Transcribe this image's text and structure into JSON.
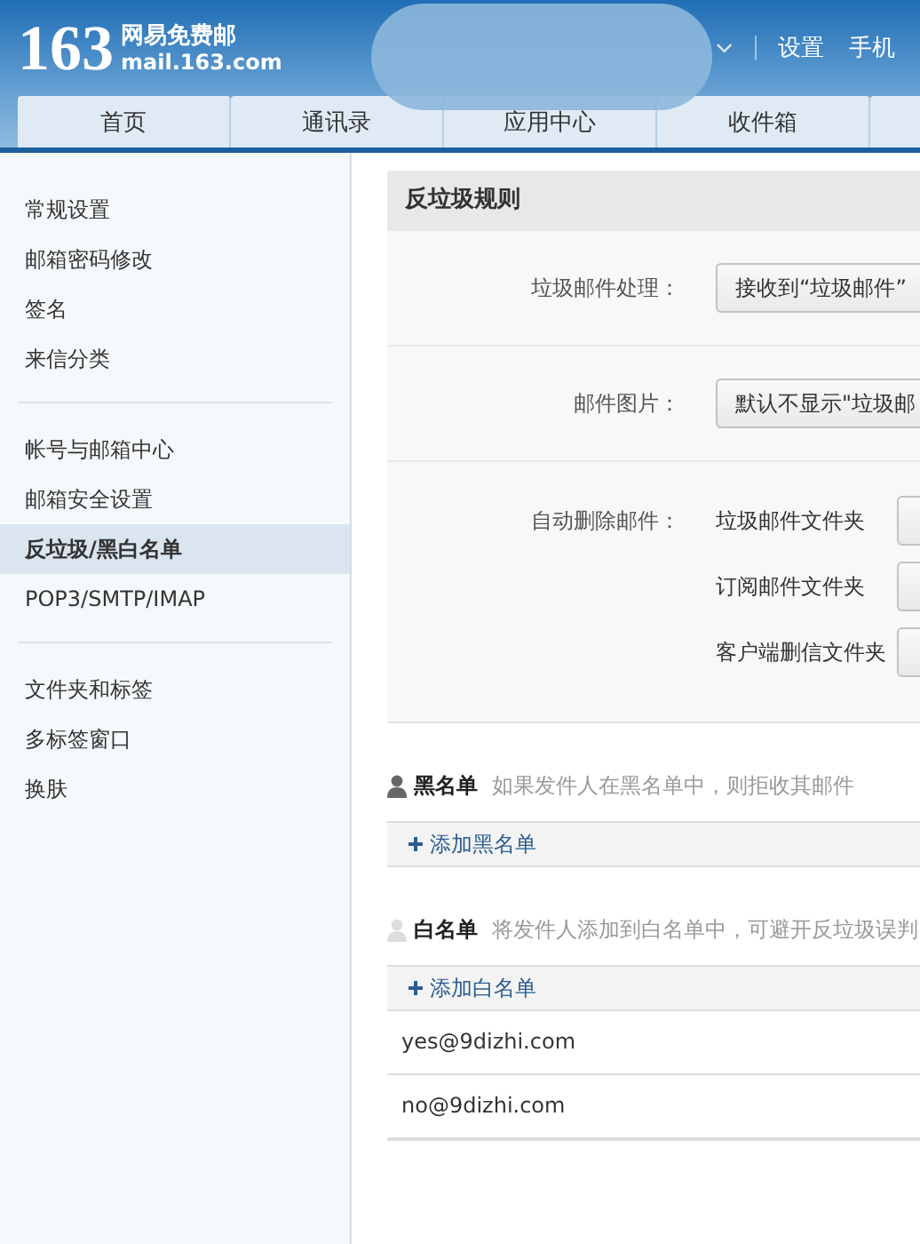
{
  "header": {
    "logo_number": "163",
    "logo_title": "网易免费邮",
    "logo_domain": "mail.163.com",
    "links": [
      "设置",
      "手机"
    ]
  },
  "tabs": [
    {
      "label": "首页"
    },
    {
      "label": "通讯录"
    },
    {
      "label": "应用中心"
    },
    {
      "label": "收件箱"
    }
  ],
  "sidebar": {
    "groups": [
      {
        "items": [
          {
            "label": "常规设置",
            "selected": false
          },
          {
            "label": "邮箱密码修改",
            "selected": false
          },
          {
            "label": "签名",
            "selected": false
          },
          {
            "label": "来信分类",
            "selected": false
          }
        ]
      },
      {
        "items": [
          {
            "label": "帐号与邮箱中心",
            "selected": false
          },
          {
            "label": "邮箱安全设置",
            "selected": false
          },
          {
            "label": "反垃圾/黑白名单",
            "selected": true
          },
          {
            "label": "POP3/SMTP/IMAP",
            "selected": false
          }
        ]
      },
      {
        "items": [
          {
            "label": "文件夹和标签",
            "selected": false
          },
          {
            "label": "多标签窗口",
            "selected": false
          },
          {
            "label": "换肤",
            "selected": false
          }
        ]
      }
    ]
  },
  "spam_rules": {
    "title": "反垃圾规则",
    "rows": [
      {
        "kind": "select",
        "label": "垃圾邮件处理：",
        "value": "接收到“垃圾邮件”"
      },
      {
        "kind": "select",
        "label": "邮件图片：",
        "value": "默认不显示\"垃圾邮"
      },
      {
        "kind": "folders",
        "label": "自动删除邮件：",
        "folders": [
          "垃圾邮件文件夹",
          "订阅邮件文件夹",
          "客户端删信文件夹"
        ]
      }
    ]
  },
  "lists": [
    {
      "kind": "black",
      "title": "黑名单",
      "description": "如果发件人在黑名单中，则拒收其邮件",
      "add": "添加黑名单"
    },
    {
      "kind": "white",
      "title": "白名单",
      "description": "将发件人添加到白名单中，可避开反垃圾误判",
      "add": "添加白名单",
      "entries": [
        "yes@9dizhi.com",
        "no@9dizhi.com"
      ]
    }
  ]
}
